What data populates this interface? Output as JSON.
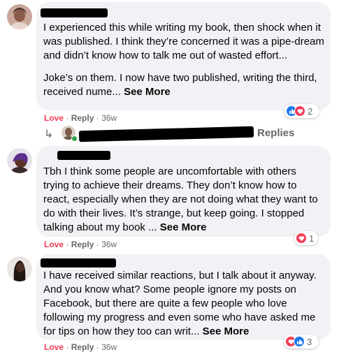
{
  "comments": [
    {
      "paragraphs": [
        "I experienced this while writing my book, then shock when it was published. I think they’re concerned it was a pipe-dream and didn’t know how to talk me out of wasted effort...",
        "Joke’s on them. I now have two published, writing the third, received nume... "
      ],
      "see_more": "See More",
      "love": "Love",
      "sep": "·",
      "reply": "Reply",
      "time": "36w",
      "reaction_count": "2",
      "reactions": [
        "like-icon",
        "love-icon"
      ]
    },
    {
      "paragraphs": [
        "Tbh I think some people are uncomfortable with others trying to achieve their dreams. They don’t know how to react, especially when they are not doing what they want to do with their lives. It’s strange, but keep going. I stopped talking about my book ... "
      ],
      "see_more": "See More",
      "love": "Love",
      "sep": "·",
      "reply": "Reply",
      "time": "36w",
      "reaction_count": "1",
      "reactions": [
        "love-icon"
      ]
    },
    {
      "paragraphs": [
        "I have received similar reactions, but I talk about it anyway. And you know what? Some people ignore my posts on Facebook, but there are quite a few people who love following my progress and even some who have asked me for tips on how they too can writ... "
      ],
      "see_more": "See More",
      "love": "Love",
      "sep": "·",
      "reply": "Reply",
      "time": "36w",
      "reaction_count": "3",
      "reactions": [
        "love-icon",
        "like-icon"
      ]
    }
  ],
  "reply_thread": {
    "arrow": "↳",
    "visible_suffix": "Replies"
  },
  "colors": {
    "love": "#f33e58",
    "like": "#1877f2",
    "bubble": "#f0f2f5",
    "meta": "#65676b"
  }
}
